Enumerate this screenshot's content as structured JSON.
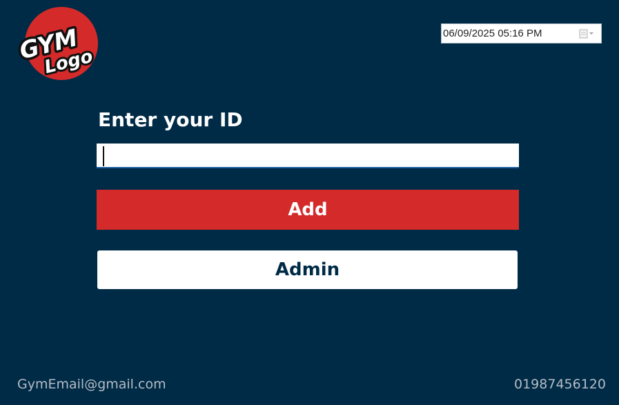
{
  "logo": {
    "line1": "GYM",
    "line2": "Logo",
    "circle_color": "#d52a2a"
  },
  "datetime": {
    "value": "06/09/2025 05:16 PM",
    "icon": "calendar-dropdown-icon"
  },
  "form": {
    "prompt": "Enter your ID",
    "id_value": "",
    "add_label": "Add",
    "admin_label": "Admin"
  },
  "footer": {
    "email": "GymEmail@gmail.com",
    "phone": "01987456120"
  },
  "colors": {
    "background": "#002b47",
    "accent_red": "#d52a2a",
    "input_underline": "#1b5fa0"
  }
}
